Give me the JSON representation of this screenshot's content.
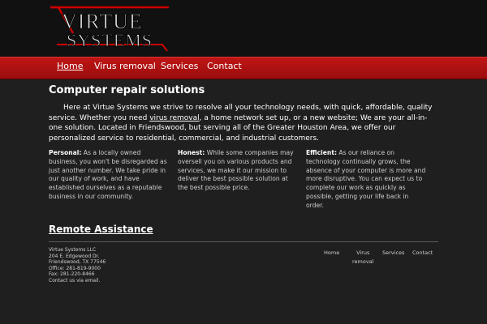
{
  "logo": {
    "line1": "VIRTUE",
    "line2": "SYSTEMS"
  },
  "nav": {
    "items": [
      {
        "label": "Home",
        "active": true
      },
      {
        "label": "Virus removal",
        "active": false
      },
      {
        "label": "Services",
        "active": false
      },
      {
        "label": "Contact",
        "active": false
      }
    ]
  },
  "main": {
    "title": "Computer repair solutions",
    "intro_before": "Here at Virtue Systems we strive to resolve all your technology needs, with quick, affordable, quality service. Whether you need ",
    "intro_link": "virus removal",
    "intro_after": ", a home network set up, or a new website; We are your all-in-one solution. Located in Friendswood, but serving all of the Greater Houston Area, we offer our personalized service to residential, commercial, and industrial customers.",
    "columns": [
      {
        "heading": "Personal:",
        "text": " As a locally owned business, you won't be disregarded as just another number. We take pride in our quality of work, and have established ourselves as a reputable business in our community."
      },
      {
        "heading": "Honest:",
        "text": " While some companies may oversell you on various products and services, we make it our mission to deliver the best possible solution at the best possible price."
      },
      {
        "heading": "Efficient:",
        "text": " As our reliance on technology continually grows, the absence of your computer is more and more disruptive. You can expect us to complete our work as quickly as possible, getting your life back in order."
      }
    ],
    "remote_link": "Remote Assistance"
  },
  "footer": {
    "company": "Virtue Systems LLC",
    "street": "204 E. Edgewood Dr.",
    "city": "Friendswood, TX 77546",
    "office": "Office: 281-819-9000",
    "fax": "Fax: 281-220-8466",
    "contact_prefix": "Contact us via ",
    "contact_link": "email",
    "contact_suffix": ".",
    "nav": {
      "home": "Home",
      "virus_line1": "Virus",
      "virus_line2": "removal",
      "services": "Services",
      "contact": "Contact"
    }
  },
  "colors": {
    "nav_red": "#b01010",
    "background": "#1f1f1f",
    "header_bg": "#111111"
  }
}
